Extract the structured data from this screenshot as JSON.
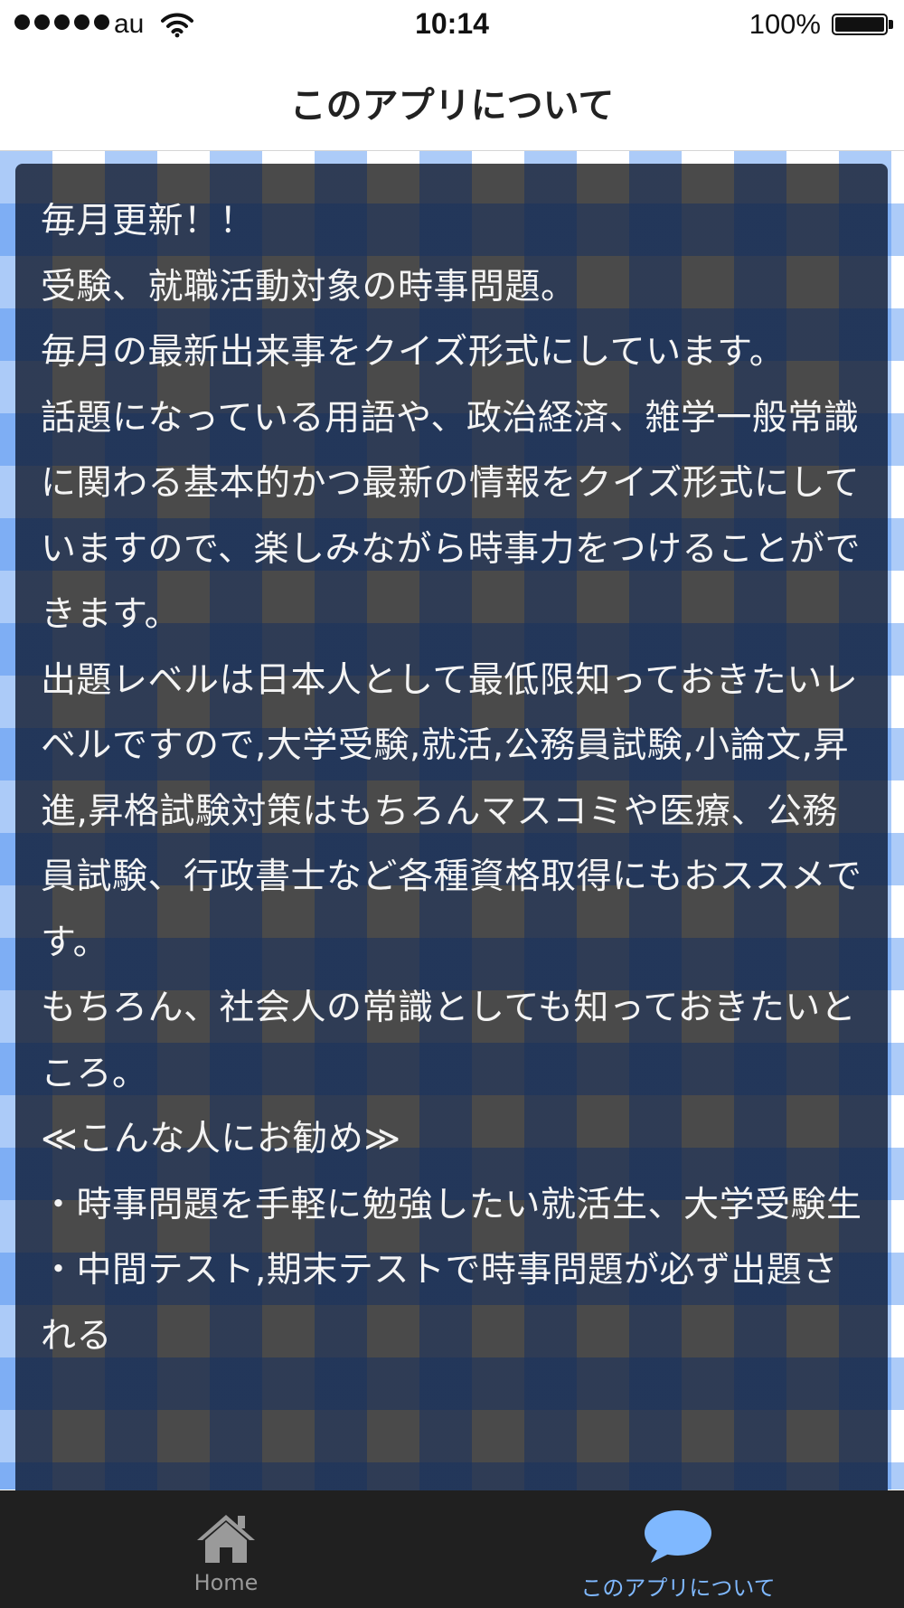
{
  "status_bar": {
    "carrier": "au",
    "time": "10:14",
    "battery": "100%"
  },
  "nav": {
    "title": "このアプリについて"
  },
  "content": {
    "body": "毎月更新！！\n受験、就職活動対象の時事問題。\n毎月の最新出来事をクイズ形式にしています。\n話題になっている用語や、政治経済、雑学一般常識に関わる基本的かつ最新の情報をクイズ形式にしていますので、楽しみながら時事力をつけることができます。\n出題レベルは日本人として最低限知っておきたいレベルですので,大学受験,就活,公務員試験,小論文,昇進,昇格試験対策はもちろんマスコミや医療、公務員試験、行政書士など各種資格取得にもおススメです。\nもちろん、社会人の常識としても知っておきたいところ。\n≪こんな人にお勧め≫\n・時事問題を手軽に勉強したい就活生、大学受験生\n・中間テスト,期末テストで時事問題が必ず出題される"
  },
  "tabs": {
    "home": {
      "label": "Home",
      "icon": "house-icon"
    },
    "about": {
      "label": "このアプリについて",
      "icon": "speech-bubble-icon",
      "active": true
    }
  },
  "colors": {
    "tab_active": "#7fb8ff",
    "tab_inactive": "#9a9a9a",
    "tabbar_bg": "#202020",
    "gingham_blue": "#468cf0"
  }
}
